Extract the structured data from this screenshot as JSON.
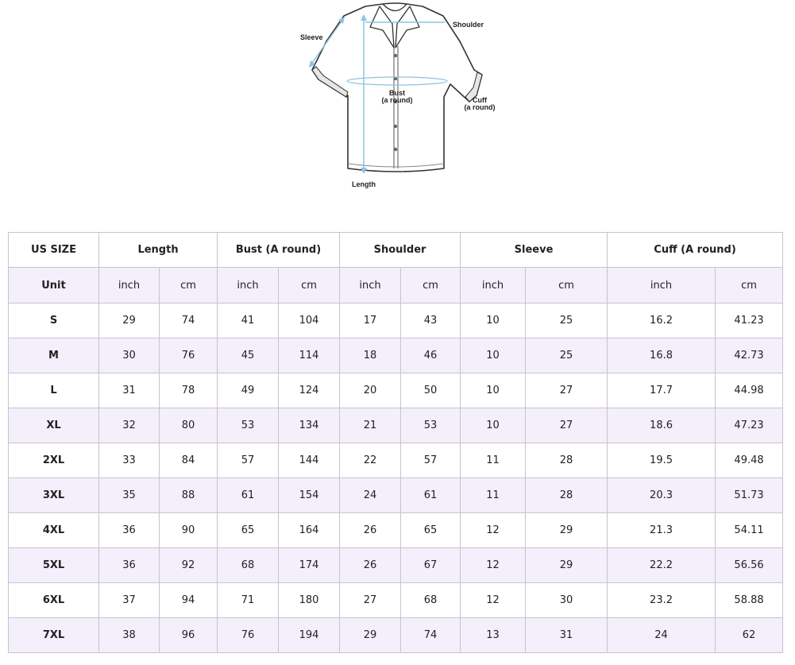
{
  "diagram": {
    "labels": {
      "sleeve": "Sleeve",
      "shoulder": "Shoulder",
      "bust_line1": "Bust",
      "bust_line2": "(a round)",
      "cuff_line1": "Cuff",
      "cuff_line2": "(a round)",
      "length": "Length"
    },
    "colors": {
      "outline": "#333333",
      "measure": "#8cc3e2"
    }
  },
  "table": {
    "headers": [
      "US SIZE",
      "Length",
      "Bust (A round)",
      "Shoulder",
      "Sleeve",
      "Cuff (A round)"
    ],
    "units": [
      "Unit",
      "inch",
      "cm",
      "inch",
      "cm",
      "inch",
      "cm",
      "inch",
      "cm",
      "inch",
      "cm"
    ],
    "rows": [
      [
        "S",
        "29",
        "74",
        "41",
        "104",
        "17",
        "43",
        "10",
        "25",
        "16.2",
        "41.23"
      ],
      [
        "M",
        "30",
        "76",
        "45",
        "114",
        "18",
        "46",
        "10",
        "25",
        "16.8",
        "42.73"
      ],
      [
        "L",
        "31",
        "78",
        "49",
        "124",
        "20",
        "50",
        "10",
        "27",
        "17.7",
        "44.98"
      ],
      [
        "XL",
        "32",
        "80",
        "53",
        "134",
        "21",
        "53",
        "10",
        "27",
        "18.6",
        "47.23"
      ],
      [
        "2XL",
        "33",
        "84",
        "57",
        "144",
        "22",
        "57",
        "11",
        "28",
        "19.5",
        "49.48"
      ],
      [
        "3XL",
        "35",
        "88",
        "61",
        "154",
        "24",
        "61",
        "11",
        "28",
        "20.3",
        "51.73"
      ],
      [
        "4XL",
        "36",
        "90",
        "65",
        "164",
        "26",
        "65",
        "12",
        "29",
        "21.3",
        "54.11"
      ],
      [
        "5XL",
        "36",
        "92",
        "68",
        "174",
        "26",
        "67",
        "12",
        "29",
        "22.2",
        "56.56"
      ],
      [
        "6XL",
        "37",
        "94",
        "71",
        "180",
        "27",
        "68",
        "12",
        "30",
        "23.2",
        "58.88"
      ],
      [
        "7XL",
        "38",
        "96",
        "76",
        "194",
        "29",
        "74",
        "13",
        "31",
        "24",
        "62"
      ]
    ],
    "colors": {
      "border": "#c9c2cf",
      "stripe": "#f3effb"
    }
  }
}
